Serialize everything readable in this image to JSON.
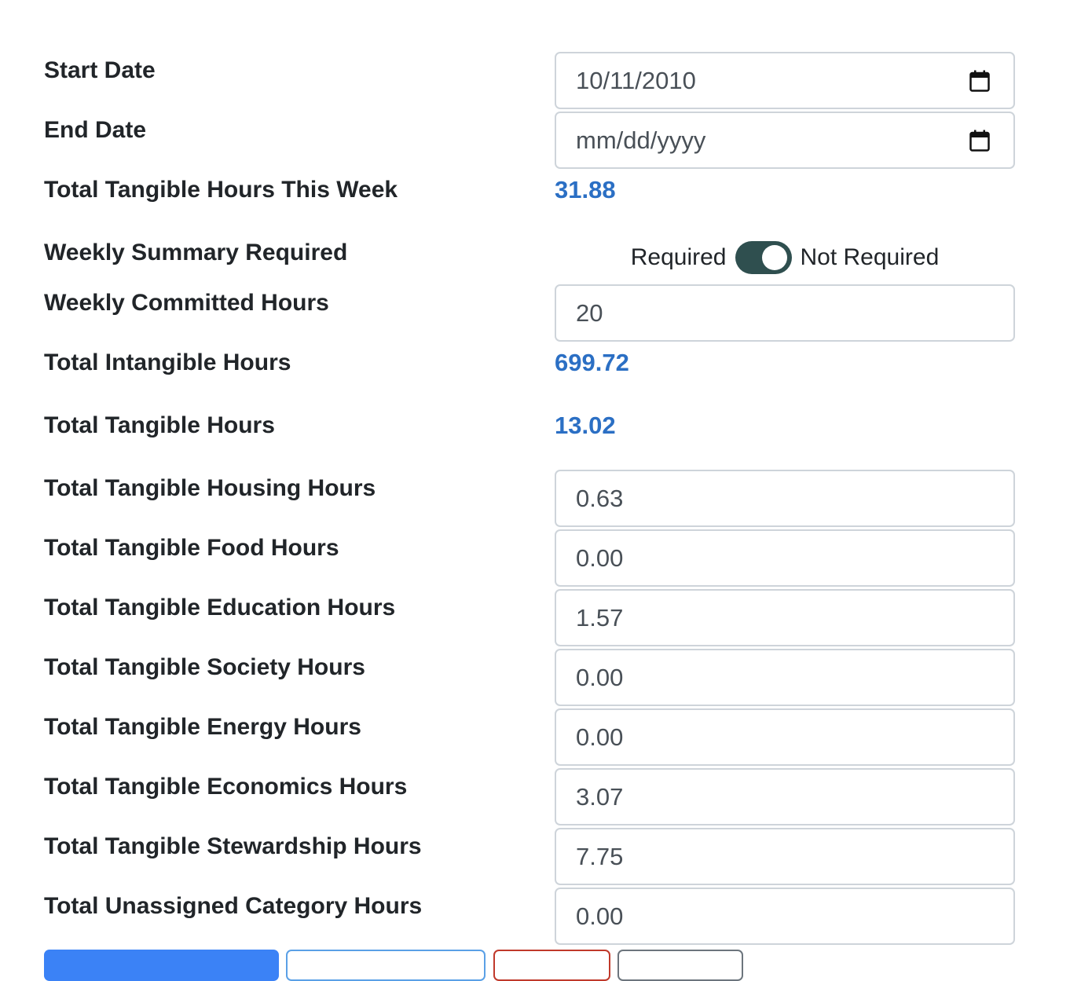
{
  "form": {
    "start_date": {
      "label": "Start Date",
      "value": "10/11/2010"
    },
    "end_date": {
      "label": "End Date",
      "placeholder": "mm/dd/yyyy"
    },
    "tangible_this_week": {
      "label": "Total Tangible Hours This Week",
      "value": "31.88"
    },
    "weekly_summary": {
      "label": "Weekly Summary Required",
      "option_left": "Required",
      "option_right": "Not Required",
      "state": "Not Required"
    },
    "committed_hours": {
      "label": "Weekly Committed Hours",
      "value": "20"
    },
    "intangible_hours": {
      "label": "Total Intangible Hours",
      "value": "699.72"
    },
    "tangible_hours": {
      "label": "Total Tangible Hours",
      "value": "13.02"
    },
    "housing_hours": {
      "label": "Total Tangible Housing Hours",
      "value": "0.63"
    },
    "food_hours": {
      "label": "Total Tangible Food Hours",
      "value": "0.00"
    },
    "education_hours": {
      "label": "Total Tangible Education Hours",
      "value": "1.57"
    },
    "society_hours": {
      "label": "Total Tangible Society Hours",
      "value": "0.00"
    },
    "energy_hours": {
      "label": "Total Tangible Energy Hours",
      "value": "0.00"
    },
    "economics_hours": {
      "label": "Total Tangible Economics Hours",
      "value": "3.07"
    },
    "stewardship_hours": {
      "label": "Total Tangible Stewardship Hours",
      "value": "7.75"
    },
    "unassigned_hours": {
      "label": "Total Unassigned Category Hours",
      "value": "0.00"
    }
  },
  "colors": {
    "stat_value": "#2b6fc4",
    "toggle_on": "#2f4f4f",
    "primary_button": "#3b82f6",
    "outline_primary": "#5aa0e6",
    "outline_danger": "#c0392b",
    "outline_secondary": "#6c757d"
  },
  "icons": {
    "date_picker": "calendar-icon"
  }
}
